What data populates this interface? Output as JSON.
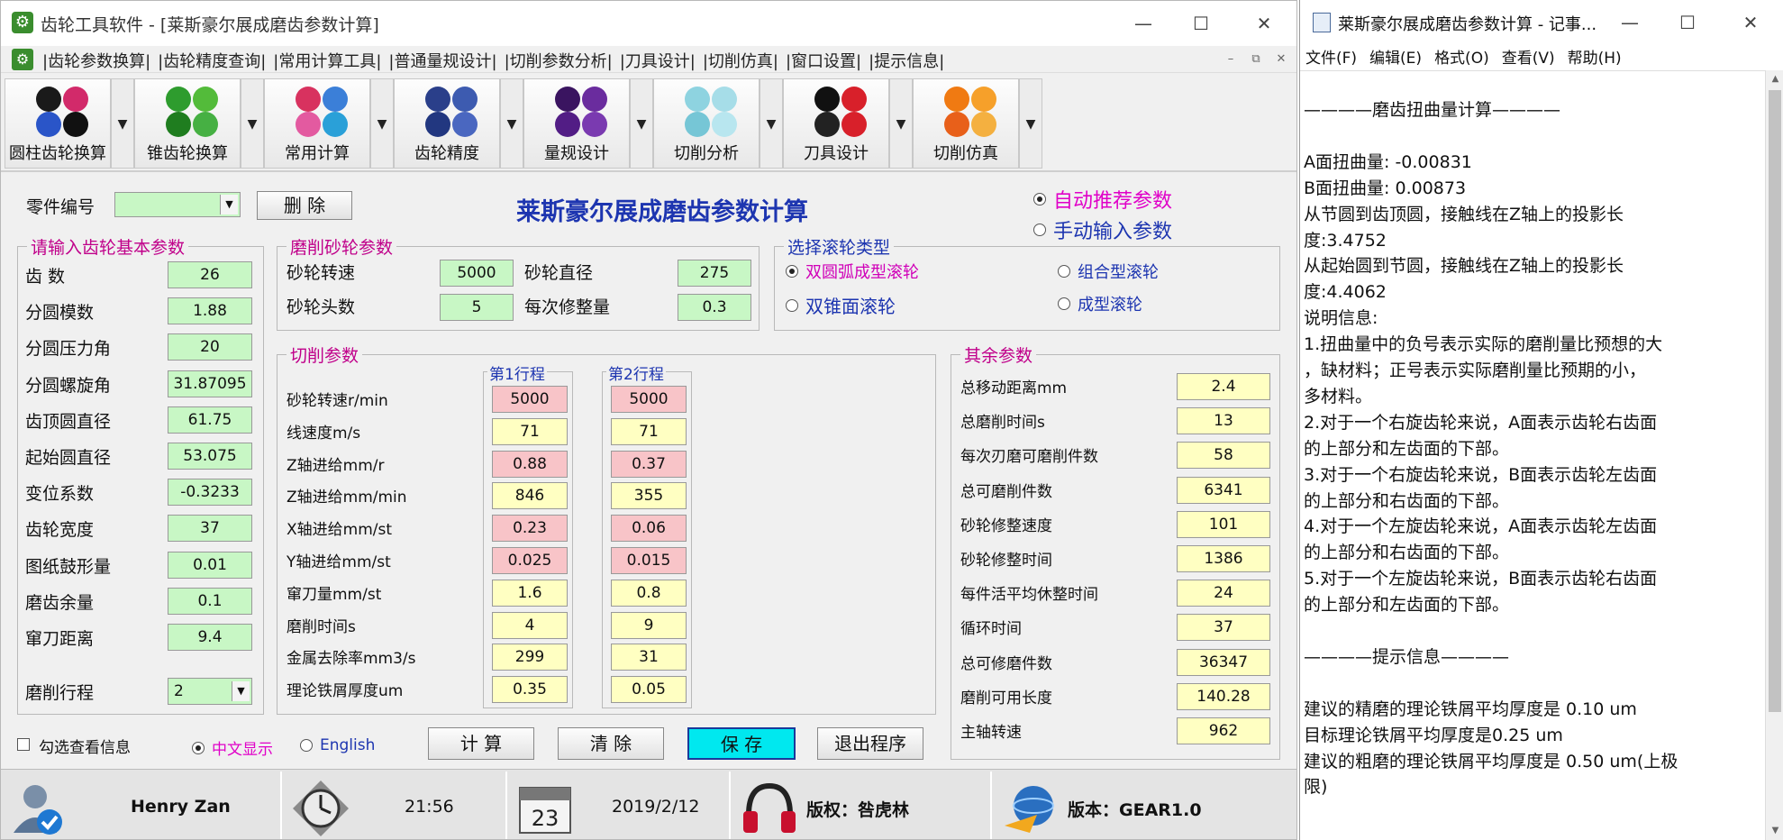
{
  "app": {
    "title": "齿轮工具软件 - [莱斯豪尔展成磨齿参数计算]",
    "menu": [
      "|齿轮参数换算|",
      "|齿轮精度查询|",
      "|常用计算工具|",
      "|普通量规设计|",
      "|切削参数分析|",
      "|刀具设计|",
      "|切削仿真|",
      "|窗口设置|",
      "|提示信息|"
    ],
    "toolbar": [
      "圆柱齿轮换算",
      "锥齿轮换算",
      "常用计算",
      "齿轮精度",
      "量规设计",
      "切削分析",
      "刀具设计",
      "切削仿真"
    ],
    "toolbar_colors": [
      [
        "#1a1a1a",
        "#d22a6a",
        "#2a55c8",
        "#111"
      ],
      [
        "#2e9c2e",
        "#53bb3a",
        "#1f7d1f",
        "#46b043"
      ],
      [
        "#d8325f",
        "#3b7fd8",
        "#e35aa0",
        "#2aa0d8"
      ],
      [
        "#2a3f8a",
        "#3d5bb0",
        "#223780",
        "#4a67c0"
      ],
      [
        "#3a1460",
        "#6a2c9e",
        "#521d85",
        "#7a3ab0"
      ],
      [
        "#8ed3e0",
        "#a6dde8",
        "#76c6d6",
        "#b8e6ef"
      ],
      [
        "#111",
        "#d8202a",
        "#222",
        "#d8202a"
      ],
      [
        "#f07a12",
        "#f6a02a",
        "#e8601a",
        "#f4b040"
      ]
    ],
    "part_no_label": "零件编号",
    "part_no_value": "",
    "delete_btn": "删 除",
    "page_title": "莱斯豪尔展成磨齿参数计算",
    "mode_auto": "自动推荐参数",
    "mode_manual": "手动输入参数",
    "basic": {
      "title": "请输入齿轮基本参数",
      "rows": [
        {
          "label": "齿 数",
          "value": "26"
        },
        {
          "label": "分圆模数",
          "value": "1.88"
        },
        {
          "label": "分圆压力角",
          "value": "20"
        },
        {
          "label": "分圆螺旋角",
          "value": "31.87095"
        },
        {
          "label": "齿顶圆直径",
          "value": "61.75"
        },
        {
          "label": "起始圆直径",
          "value": "53.075"
        },
        {
          "label": "变位系数",
          "value": "-0.3233"
        },
        {
          "label": "齿轮宽度",
          "value": "37"
        },
        {
          "label": "图纸鼓形量",
          "value": "0.01"
        },
        {
          "label": "磨齿余量",
          "value": "0.1"
        },
        {
          "label": "窜刀距离",
          "value": "9.4"
        }
      ],
      "pass_label": "磨削行程",
      "pass_value": "2"
    },
    "wheel": {
      "title": "磨削砂轮参数",
      "speed_label": "砂轮转速",
      "speed_value": "5000",
      "dia_label": "砂轮直径",
      "dia_value": "275",
      "heads_label": "砂轮头数",
      "heads_value": "5",
      "dress_label": "每次修整量",
      "dress_value": "0.3"
    },
    "roller": {
      "title": "选择滚轮类型",
      "opt1": "双圆弧成型滚轮",
      "opt2": "组合型滚轮",
      "opt3": "双锥面滚轮",
      "opt4": "成型滚轮"
    },
    "cutting": {
      "title": "切削参数",
      "col1": "第1行程",
      "col2": "第2行程",
      "rows": [
        {
          "label": "砂轮转速r/min",
          "v1": "5000",
          "v2": "5000",
          "pink": true
        },
        {
          "label": "线速度m/s",
          "v1": "71",
          "v2": "71",
          "pink": false
        },
        {
          "label": "Z轴进给mm/r",
          "v1": "0.88",
          "v2": "0.37",
          "pink": true
        },
        {
          "label": "Z轴进给mm/min",
          "v1": "846",
          "v2": "355",
          "pink": false
        },
        {
          "label": "X轴进给mm/st",
          "v1": "0.23",
          "v2": "0.06",
          "pink": true
        },
        {
          "label": "Y轴进给mm/st",
          "v1": "0.025",
          "v2": "0.015",
          "pink": true
        },
        {
          "label": "窜刀量mm/st",
          "v1": "1.6",
          "v2": "0.8",
          "pink": false
        },
        {
          "label": "磨削时间s",
          "v1": "4",
          "v2": "9",
          "pink": false
        },
        {
          "label": "金属去除率mm3/s",
          "v1": "299",
          "v2": "31",
          "pink": false
        },
        {
          "label": "理论铁屑厚度um",
          "v1": "0.35",
          "v2": "0.05",
          "pink": false
        }
      ]
    },
    "other": {
      "title": "其余参数",
      "rows": [
        {
          "label": "总移动距离mm",
          "value": "2.4"
        },
        {
          "label": "总磨削时间s",
          "value": "13"
        },
        {
          "label": "每次刃磨可磨削件数",
          "value": "58"
        },
        {
          "label": "总可磨削件数",
          "value": "6341"
        },
        {
          "label": "砂轮修整速度",
          "value": "101"
        },
        {
          "label": "砂轮修整时间",
          "value": "1386"
        },
        {
          "label": "每件活平均休整时间",
          "value": "24"
        },
        {
          "label": "循环时间",
          "value": "37"
        },
        {
          "label": "总可修磨件数",
          "value": "36347"
        },
        {
          "label": "磨削可用长度",
          "value": "140.28"
        },
        {
          "label": "主轴转速",
          "value": "962"
        }
      ]
    },
    "check_info": "勾选查看信息",
    "lang_cn": "中文显示",
    "lang_en": "English",
    "btn_calc": "计 算",
    "btn_clear": "清 除",
    "btn_save": "保 存",
    "btn_exit": "退出程序",
    "status": {
      "user": "Henry Zan",
      "time": "21:56",
      "date": "2019/2/12",
      "calendar_day": "23",
      "copyright": "版权：咎虎林",
      "version": "版本：GEAR1.0"
    }
  },
  "notepad": {
    "title": "莱斯豪尔展成磨齿参数计算 - 记事...",
    "menu": [
      "文件(F)",
      "编辑(E)",
      "格式(O)",
      "查看(V)",
      "帮助(H)"
    ],
    "lines": [
      "————磨齿扭曲量计算————",
      "",
      "A面扭曲量:                  -0.00831",
      "B面扭曲量:                  0.00873",
      "从节圆到齿顶圆，接触线在Z轴上的投影长",
      "度:3.4752",
      "从起始圆到节圆，接触线在Z轴上的投影长",
      "度:4.4062",
      "说明信息:",
      "1.扭曲量中的负号表示实际的磨削量比预想的大",
      "，缺材料；正号表示实际磨削量比预期的小，",
      "多材料。",
      "2.对于一个右旋齿轮来说，A面表示齿轮右齿面",
      "的上部分和左齿面的下部。",
      "3.对于一个右旋齿轮来说，B面表示齿轮左齿面",
      "的上部分和右齿面的下部。",
      "4.对于一个左旋齿轮来说，A面表示齿轮左齿面",
      "的上部分和右齿面的下部。",
      "5.对于一个左旋齿轮来说，B面表示齿轮右齿面",
      "的上部分和左齿面的下部。",
      "",
      "————提示信息————",
      "",
      "建议的精磨的理论铁屑平均厚度是 0.10 um",
      "目标理论铁屑平均厚度是0.25 um",
      "建议的粗磨的理论铁屑平均厚度是 0.50 um(上极",
      "限)"
    ]
  }
}
